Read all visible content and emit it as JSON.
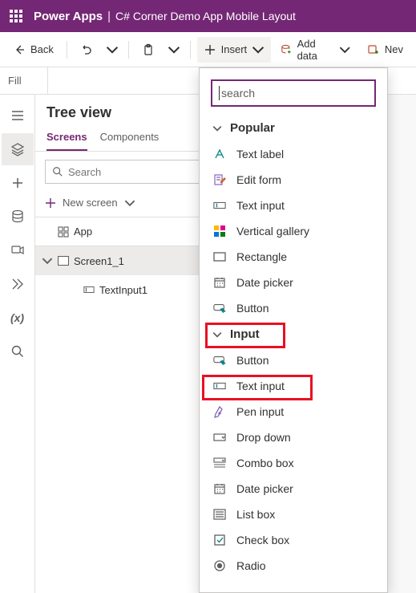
{
  "header": {
    "product": "Power Apps",
    "separator": "|",
    "appname": "C# Corner Demo App Mobile Layout"
  },
  "cmdbar": {
    "back": "Back",
    "insert": "Insert",
    "add_data": "Add data",
    "new_screen": "Nev"
  },
  "formulabar": {
    "prop": "Fill"
  },
  "treeview": {
    "title": "Tree view",
    "tabs": {
      "screens": "Screens",
      "components": "Components"
    },
    "search_ph": "Search",
    "new_screen": "New screen",
    "items": {
      "app": "App",
      "screen": "Screen1_1",
      "textinput": "TextInput1"
    }
  },
  "insert": {
    "search_ph": "search",
    "search_initial": "S",
    "cat_popular": "Popular",
    "cat_input": "Input",
    "popular": [
      {
        "k": "text-label",
        "label": "Text label"
      },
      {
        "k": "edit-form",
        "label": "Edit form"
      },
      {
        "k": "text-input",
        "label": "Text input"
      },
      {
        "k": "vertical-gallery",
        "label": "Vertical gallery"
      },
      {
        "k": "rectangle",
        "label": "Rectangle"
      },
      {
        "k": "date-picker",
        "label": "Date picker"
      },
      {
        "k": "button",
        "label": "Button"
      }
    ],
    "input": [
      {
        "k": "button",
        "label": "Button"
      },
      {
        "k": "text-input",
        "label": "Text input"
      },
      {
        "k": "pen-input",
        "label": "Pen input"
      },
      {
        "k": "drop-down",
        "label": "Drop down"
      },
      {
        "k": "combo-box",
        "label": "Combo box"
      },
      {
        "k": "date-picker",
        "label": "Date picker"
      },
      {
        "k": "list-box",
        "label": "List box"
      },
      {
        "k": "check-box",
        "label": "Check box"
      },
      {
        "k": "radio",
        "label": "Radio"
      }
    ]
  }
}
